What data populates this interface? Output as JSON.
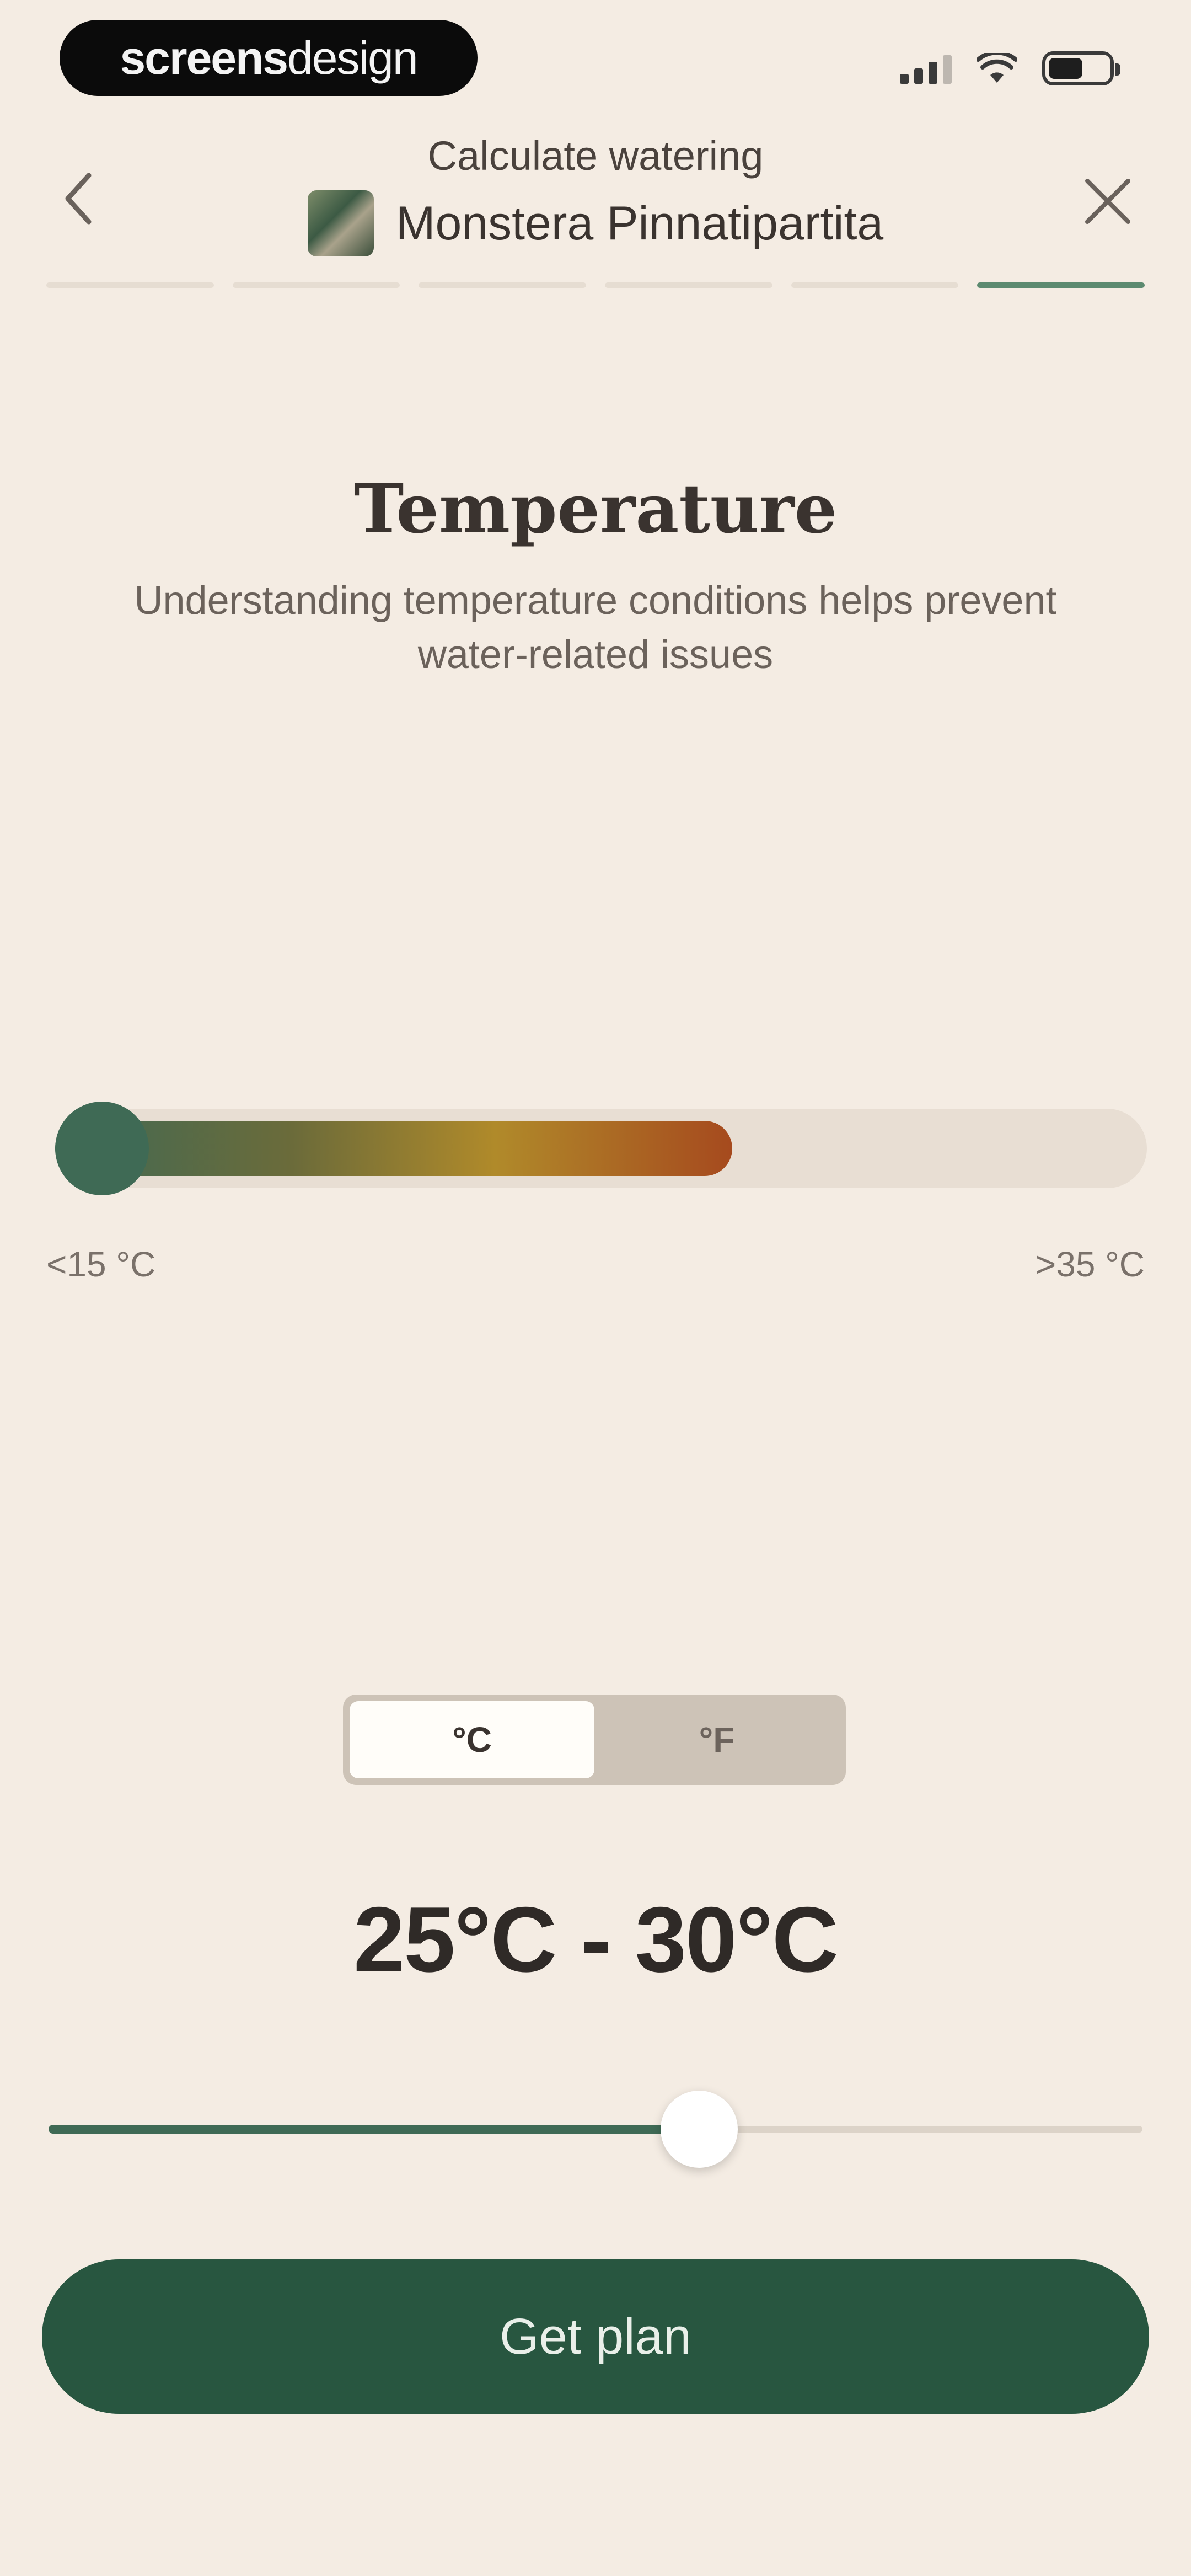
{
  "status_bar": {
    "brand_bold": "screens",
    "brand_light": "design"
  },
  "header": {
    "subtitle": "Calculate watering",
    "plant_name": "Monstera Pinnatipartita",
    "steps_total": 6,
    "active_step": 6
  },
  "section": {
    "title": "Temperature",
    "description": "Understanding temperature conditions helps prevent water-related issues"
  },
  "thermometer": {
    "min_label": "<15 °C",
    "max_label": ">35 °C",
    "level_fraction": 0.62
  },
  "unit_toggle": {
    "options": [
      "°C",
      "°F"
    ],
    "selected": "°C"
  },
  "range": {
    "value_text": "25°C - 30°C",
    "slider_fraction": 0.595
  },
  "cta": {
    "label": "Get plan"
  },
  "colors": {
    "background": "#f4ece3",
    "primary": "#285640",
    "accent_green": "#3f6a55",
    "warm": "#a64a1e"
  }
}
